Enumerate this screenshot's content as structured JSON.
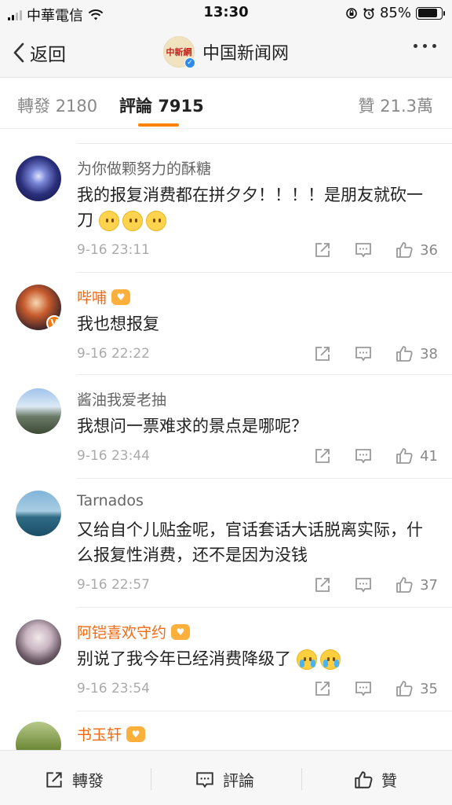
{
  "status_bar": {
    "carrier": "中華電信",
    "time": "13:30",
    "battery": "85%",
    "battery_level": 0.85
  },
  "nav": {
    "back_label": "返回",
    "title": "中国新闻网",
    "logo_text": "中新網"
  },
  "tabs": {
    "repost_label": "轉發",
    "repost_count": "2180",
    "comment_label": "評論",
    "comment_count": "7915",
    "like_label": "贊",
    "like_count": "21.3萬"
  },
  "comments": [
    {
      "username": "为你做颗努力的酥糖",
      "vip": false,
      "text": "我的报复消费都在拼夕夕！！！！是朋友就砍一刀",
      "emojis": [
        "smile-emoji",
        "smile-emoji",
        "smile-emoji"
      ],
      "time": "9-16 23:11",
      "likes": "36"
    },
    {
      "username": "哔哺",
      "vip": true,
      "text": "我也想报复",
      "time": "9-16 22:22",
      "likes": "38"
    },
    {
      "username": "酱油我爱老抽",
      "vip": false,
      "text": "我想问一票难求的景点是哪呢？",
      "time": "9-16 23:44",
      "likes": "41"
    },
    {
      "username": "Tarnados",
      "vip": false,
      "text": "又给自个儿贴金呢，官话套话大话脱离实际，什么报复性消费，还不是因为没钱",
      "time": "9-16 22:57",
      "likes": "37"
    },
    {
      "username": "阿铠喜欢守约",
      "vip": true,
      "text": "别说了我今年已经消费降级了",
      "emojis": [
        "cry-emoji",
        "cry-emoji"
      ],
      "time": "9-16 23:54",
      "likes": "35"
    },
    {
      "username": "书玉轩",
      "vip": true
    }
  ],
  "bottom_bar": {
    "repost_label": "轉發",
    "comment_label": "評論",
    "like_label": "贊"
  },
  "colors": {
    "accent": "#ff8200",
    "vip_name": "#f26a12"
  }
}
